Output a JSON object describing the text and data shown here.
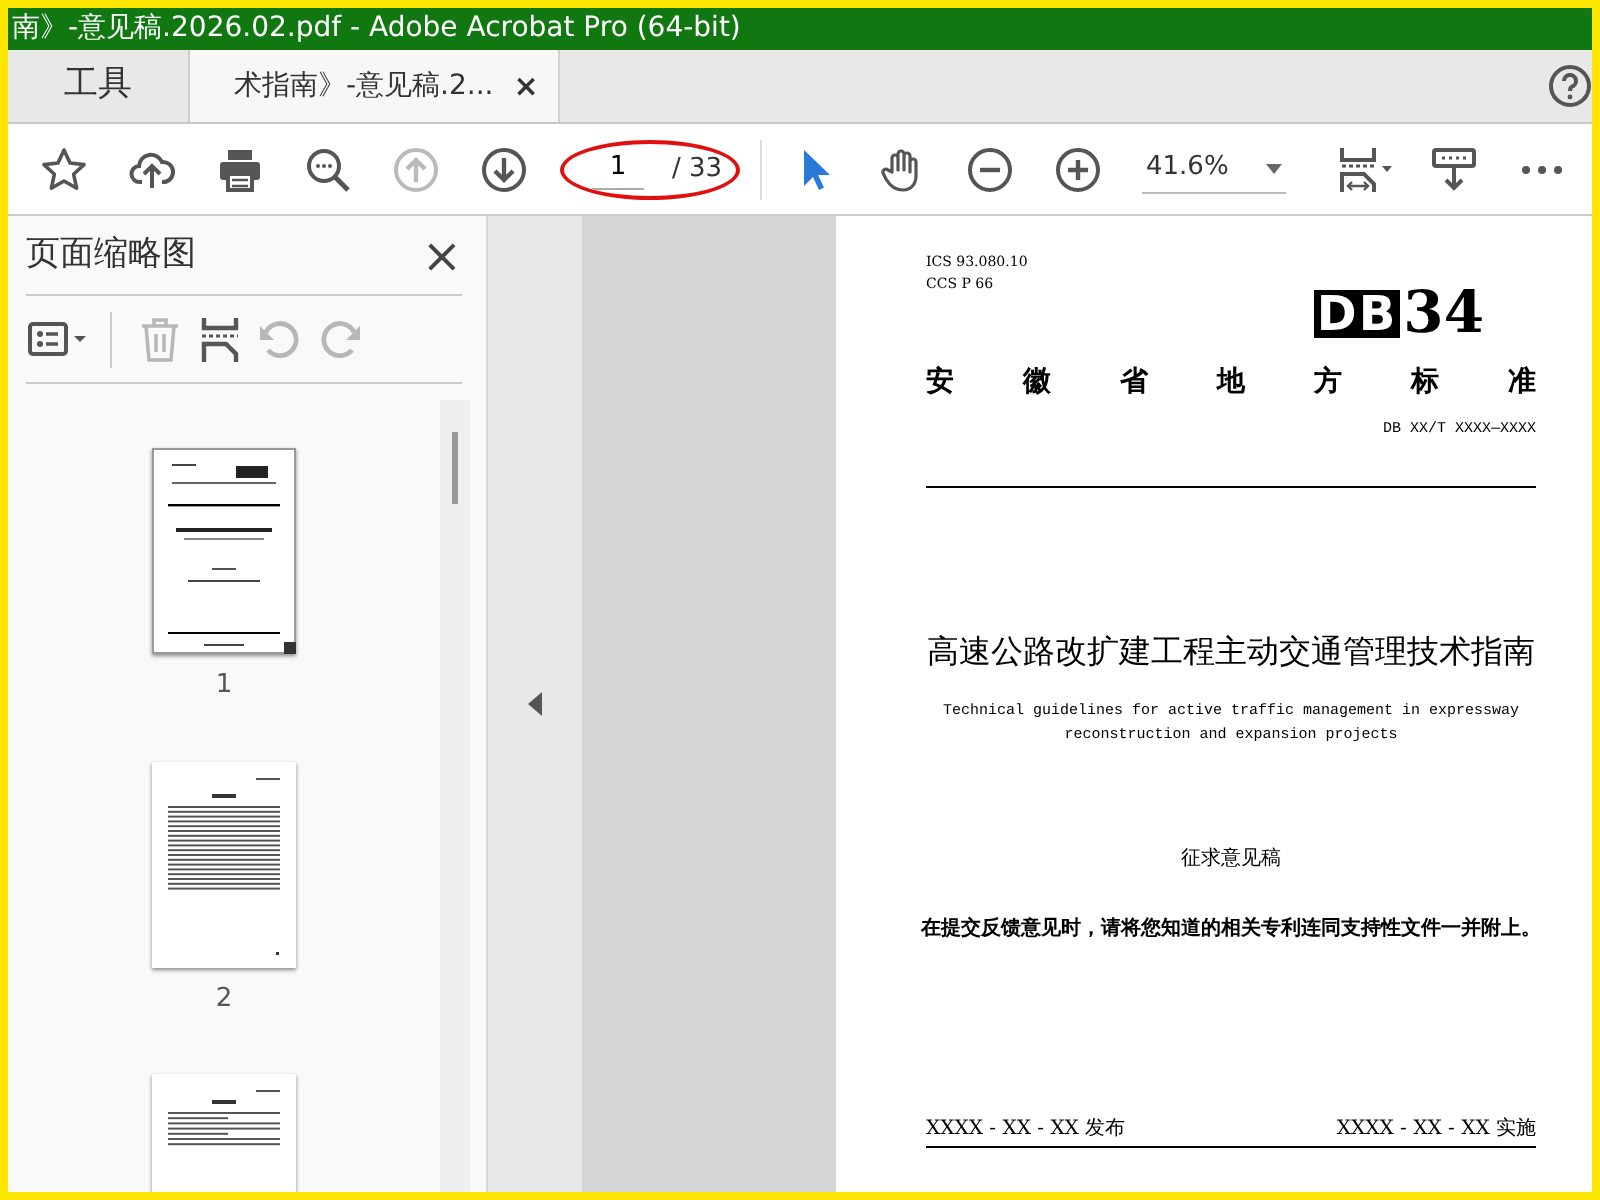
{
  "window": {
    "title": "南》-意见稿.2026.02.pdf - Adobe Acrobat Pro (64-bit)"
  },
  "tabs": [
    {
      "label": "工具",
      "selected": false
    },
    {
      "label": "术指南》-意见稿.2...",
      "selected": true,
      "close": "×"
    }
  ],
  "toolbar": {
    "left_tools": [
      {
        "kind": "star",
        "disabled": false,
        "selected": false
      },
      {
        "kind": "upload",
        "disabled": false,
        "selected": false
      },
      {
        "kind": "print",
        "disabled": false,
        "selected": false
      },
      {
        "kind": "zoom_search",
        "disabled": false,
        "selected": false
      },
      {
        "kind": "page_up",
        "disabled": true,
        "selected": false
      },
      {
        "kind": "page_down",
        "disabled": false,
        "selected": false
      }
    ],
    "page": {
      "current": "1",
      "total": "/ 33",
      "highlighted": true
    },
    "right_tools": [
      {
        "kind": "pointer",
        "disabled": false,
        "selected": true
      },
      {
        "kind": "hand",
        "disabled": false,
        "selected": false
      },
      {
        "kind": "zoom_out",
        "disabled": false,
        "selected": false
      },
      {
        "kind": "zoom_in",
        "disabled": false,
        "selected": false
      }
    ],
    "zoom": {
      "value": "41.6%"
    },
    "end_tools": [
      {
        "kind": "fit_page",
        "disabled": false,
        "selected": false
      },
      {
        "kind": "read_mode",
        "disabled": false,
        "selected": false
      },
      {
        "kind": "more",
        "disabled": false,
        "selected": false
      }
    ]
  },
  "sidebar": {
    "title": "页面缩略图",
    "close": "×",
    "tools": [
      {
        "kind": "options",
        "disabled": false
      },
      {
        "kind": "delete",
        "disabled": true
      },
      {
        "kind": "insert",
        "disabled": false
      },
      {
        "kind": "rotate_left",
        "disabled": true
      },
      {
        "kind": "rotate_right",
        "disabled": true
      }
    ],
    "thumbnails": [
      {
        "kind": "cover",
        "label": "1",
        "selected": true
      },
      {
        "kind": "toc",
        "label": "2",
        "selected": false
      },
      {
        "kind": "text",
        "selected": false
      }
    ]
  },
  "document": {
    "ics": "ICS  93.080.10",
    "ccs": "CCS  P 66",
    "logo_prefix": "DB",
    "logo_number": "34",
    "authority": "安徽省地方标准",
    "standard_number": "DB XX/T XXXX—XXXX",
    "title": "高速公路改扩建工程主动交通管理技术指南",
    "subtitle": "Technical guidelines for active traffic management in expressway reconstruction and expansion projects",
    "stage": "征求意见稿",
    "notice": "在提交反馈意见时，请将您知道的相关专利连同支持性文件一并附上。",
    "issued": "XXXX - XX - XX 发布",
    "effective": "XXXX - XX - XX 实施"
  }
}
